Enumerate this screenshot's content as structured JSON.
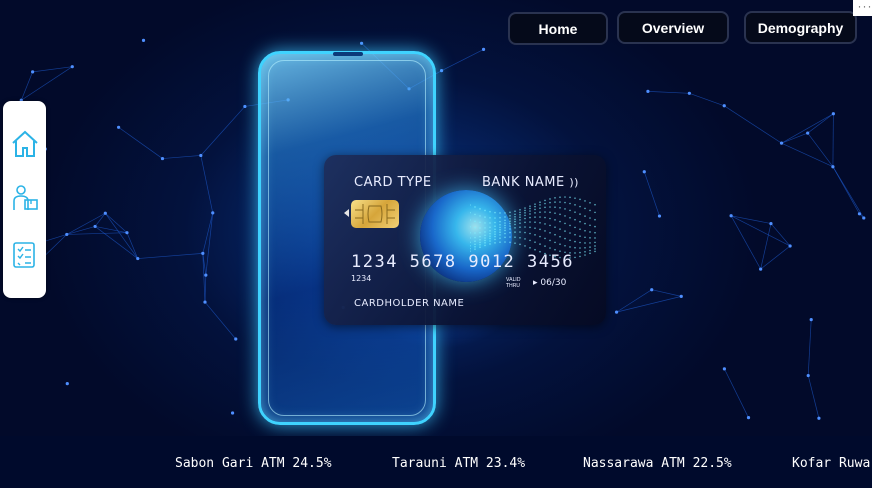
{
  "nav": {
    "home": "Home",
    "overview": "Overview",
    "demography": "Demography"
  },
  "menu": {
    "more": "···"
  },
  "sidebar": {
    "items": [
      {
        "icon": "home-icon"
      },
      {
        "icon": "delivery-person-icon"
      },
      {
        "icon": "checklist-icon"
      }
    ]
  },
  "card": {
    "type": "CARD TYPE",
    "bank": "BANK NAME",
    "number": "1234  5678  9012  3456",
    "small": "1234",
    "valid_thru": "VALID THRU",
    "expiry": "06/30",
    "holder": "CARDHOLDER NAME"
  },
  "ticker": {
    "items": [
      "Sabon Gari ATM 24.5%",
      "Tarauni ATM 23.4%",
      "Nassarawa ATM 22.5%",
      "Kofar Ruwa"
    ]
  },
  "colors": {
    "accent": "#3fd3ff",
    "background": "#020a2a",
    "ticker_bg": "#000a2c"
  }
}
